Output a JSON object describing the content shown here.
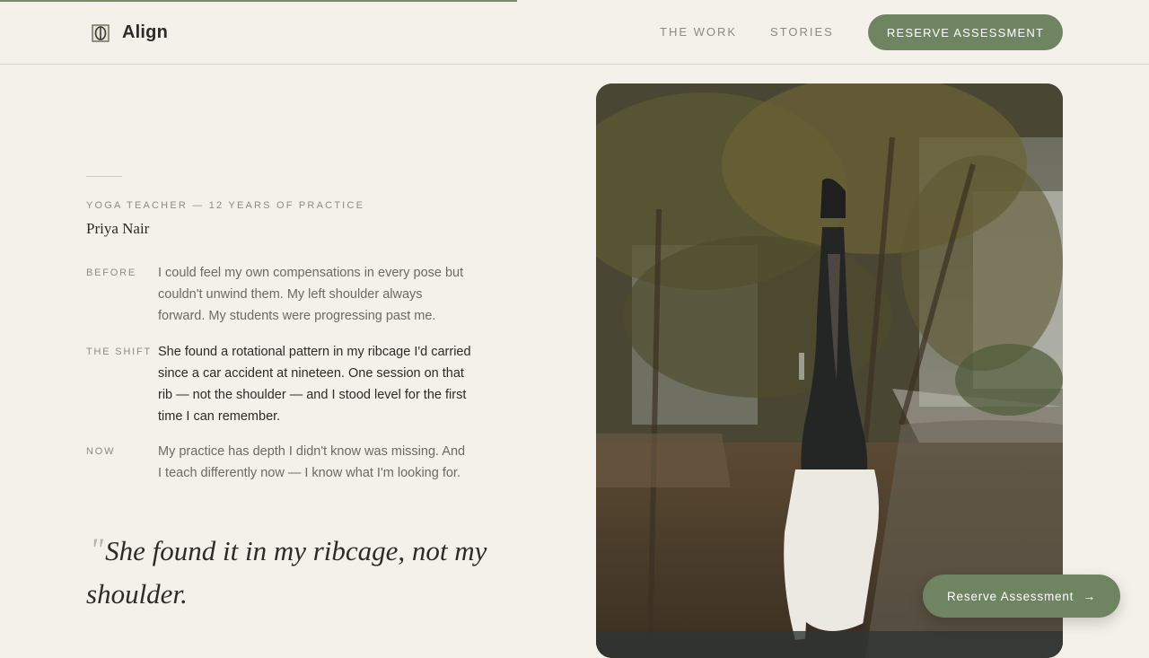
{
  "brand": {
    "name": "Align"
  },
  "nav": {
    "work": "THE WORK",
    "stories": "STORIES",
    "cta": "RESERVE ASSESSMENT"
  },
  "story": {
    "eyebrow": "YOGA TEACHER — 12 YEARS OF PRACTICE",
    "name": "Priya Nair",
    "rows": [
      {
        "label": "BEFORE",
        "text": "I could feel my own compensations in every pose but couldn't unwind them. My left shoulder always forward. My students were progressing past me."
      },
      {
        "label": "THE SHIFT",
        "text": "She found a rotational pattern in my ribcage I'd carried since a car accident at nineteen. One session on that rib — not the shoulder — and I stood level for the first time I can remember."
      },
      {
        "label": "NOW",
        "text": "My practice has depth I didn't know was missing. And I teach differently now — I know what I'm looking for."
      }
    ],
    "quote_mark": "\"",
    "quote": "She found it in my ribcage, not my shoulder."
  },
  "floating_cta": {
    "label": "Reserve Assessment",
    "icon": "arrow-right-icon"
  },
  "colors": {
    "accent": "#6f8562",
    "background": "#f4f0ea",
    "progress": "#7a8a66"
  },
  "scroll_progress": 0.45
}
